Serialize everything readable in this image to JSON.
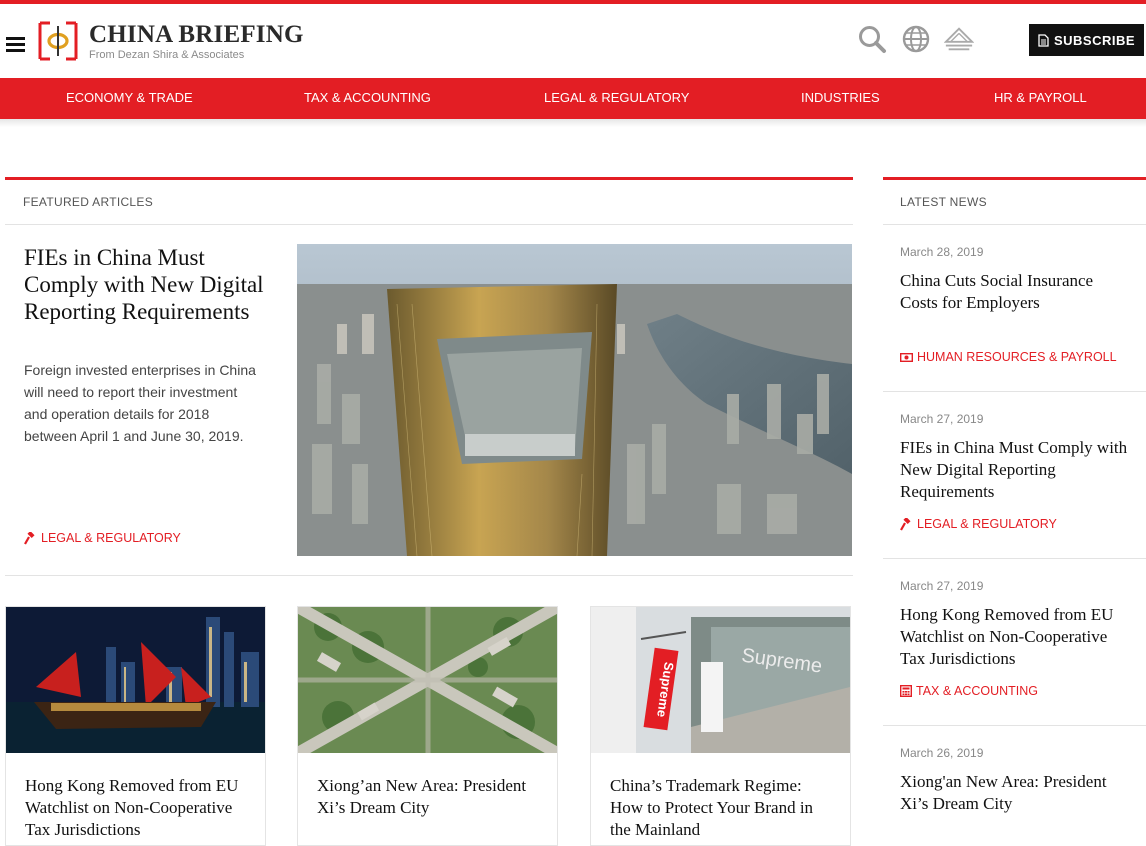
{
  "header": {
    "logo_title": "China Briefing",
    "logo_subtitle": "From Dezan Shira & Associates",
    "subscribe_label": "SUBSCRIBE"
  },
  "nav": {
    "items": [
      "ECONOMY & TRADE",
      "TAX & ACCOUNTING",
      "LEGAL & REGULATORY",
      "INDUSTRIES",
      "HR & PAYROLL"
    ]
  },
  "featured": {
    "heading": "FEATURED ARTICLES",
    "main": {
      "title": "FIEs in China Must Comply with New Digital Reporting Requirements",
      "description": "Foreign invested enterprises in China will need to report their investment and operation details for 2018 between April 1 and June 30, 2019.",
      "tag": "LEGAL & REGULATORY",
      "tag_icon": "gavel-icon"
    },
    "cards": [
      {
        "title": "Hong Kong Removed from EU Watchlist on Non-Cooperative Tax Jurisdictions"
      },
      {
        "title": "Xiong’an New Area: President Xi’s Dream City"
      },
      {
        "title": "China’s Trademark Regime: How to Protect Your Brand in the Mainland"
      }
    ]
  },
  "latest": {
    "heading": "LATEST NEWS",
    "items": [
      {
        "date": "March 28, 2019",
        "title": "China Cuts Social Insurance Costs for Employers",
        "tag": "HUMAN RESOURCES & PAYROLL",
        "tag_icon": "money-icon"
      },
      {
        "date": "March 27, 2019",
        "title": "FIEs in China Must Comply with New Digital Reporting Requirements",
        "tag": "LEGAL & REGULATORY",
        "tag_icon": "gavel-icon"
      },
      {
        "date": "March 27, 2019",
        "title": "Hong Kong Removed from EU Watchlist on Non-Cooperative Tax Jurisdictions",
        "tag": "TAX & ACCOUNTING",
        "tag_icon": "calculator-icon"
      },
      {
        "date": "March 26, 2019",
        "title": "Xiong'an New Area: President Xi’s Dream City"
      }
    ]
  },
  "colors": {
    "accent": "#e31e24",
    "text_dark": "#111111",
    "muted": "#888888"
  }
}
